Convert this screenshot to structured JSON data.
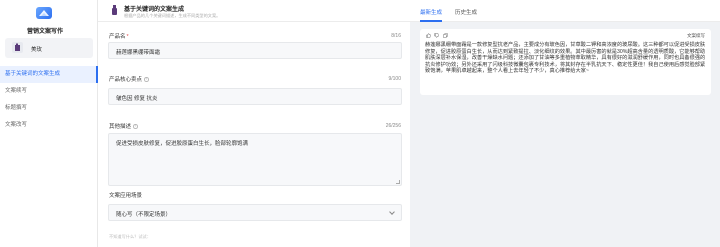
{
  "sidebar": {
    "app_title": "营销文案写作",
    "user_name": "美玫",
    "nav": [
      {
        "label": "基于关键词的文案生成",
        "active": true
      },
      {
        "label": "文案续写",
        "active": false
      },
      {
        "label": "标题撰写",
        "active": false
      },
      {
        "label": "文案改写",
        "active": false
      }
    ]
  },
  "header": {
    "title": "基于关键词的文案生成",
    "subtitle": "根据产品的几个关键词描述，生成不同类型的文案。"
  },
  "form": {
    "product_name": {
      "label": "产品名",
      "value": "赫莲娜黑绷带面霜",
      "counter": "8/16"
    },
    "selling_points": {
      "label": "产品核心卖点",
      "value": "皱色因  修复  抗炎",
      "counter": "9/100"
    },
    "other_desc": {
      "label": "其他描述",
      "value": "促进受损皮肤修复，促进胶原蛋白生长，脸部轮廓饱满",
      "counter": "26/256"
    },
    "scenario": {
      "label": "文案应用场景",
      "value": "随心写（不限定场景）"
    },
    "hint": "不知道写什么？试试："
  },
  "right": {
    "tabs": [
      "最新生成",
      "历史生成"
    ],
    "active_tab": 0,
    "doc_tag": "文案续写",
    "result_text": "赫莲娜黑绷带面霜是一款修复型抗老产品，主要成分有玻色因，甘草酸二钾和高浓度的玻尿酸。这三种都可以促进受损皮肤修复，促进胶原蛋白生长，从而达到紧致提拉、淡化细纹的效果。其中最厉害的就是30%超高含量的透明质酸，它能够帮助肌肤深层补水保湿，改善干燥缺水问题；还添加了甘油等多重植物萃取精华，具有很好的滋润舒缓作用，同时也具备很强的抗炎修护功效；另外还采用了闪级科技微囊包裹专利技术，将其封存在半乳抗天下、稳定性更佳！我自己使用后感觉脸部紧致饱满，苹果肌卓越起来，整个人看上去年轻了不少，真心推荐给大家~",
    "colors": {
      "accent": "#2d6ff0"
    }
  }
}
